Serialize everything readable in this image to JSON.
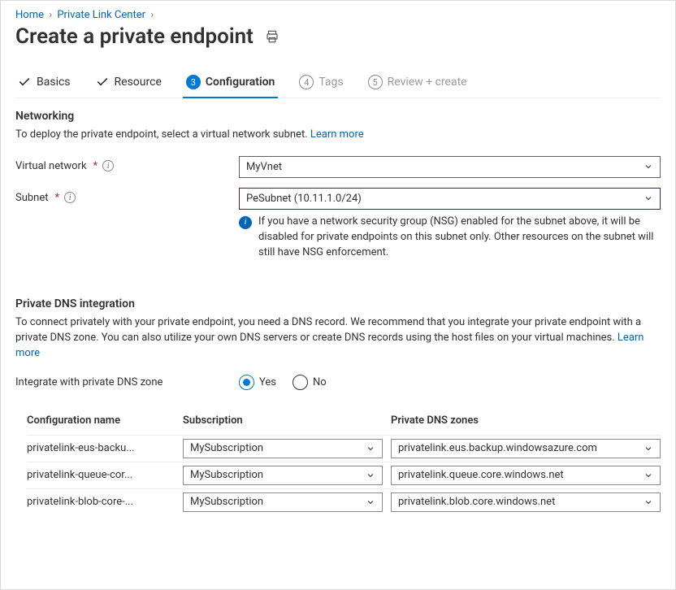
{
  "breadcrumb": {
    "home": "Home",
    "plc": "Private Link Center"
  },
  "title": "Create a private endpoint",
  "tabs": {
    "basics": "Basics",
    "resource": "Resource",
    "configuration_num": "3",
    "configuration": "Configuration",
    "tags_num": "4",
    "tags": "Tags",
    "review_num": "5",
    "review": "Review + create"
  },
  "networking": {
    "heading": "Networking",
    "desc": "To deploy the private endpoint, select a virtual network subnet.  ",
    "learn": "Learn more",
    "vnet_label": "Virtual network",
    "vnet_value": "MyVnet",
    "subnet_label": "Subnet",
    "subnet_value": "PeSubnet (10.11.1.0/24)",
    "nsg_info": "If you have a network security group (NSG) enabled for the subnet above, it will be disabled for private endpoints on this subnet only. Other resources on the subnet will still have NSG enforcement."
  },
  "dns": {
    "heading": "Private DNS integration",
    "desc": "To connect privately with your private endpoint, you need a DNS record. We recommend that you integrate your private endpoint with a private DNS zone. You can also utilize your own DNS servers or create DNS records using the host files on your virtual machines.  ",
    "learn": "Learn more",
    "integrate_label": "Integrate with private DNS zone",
    "yes": "Yes",
    "no": "No",
    "col_config": "Configuration name",
    "col_sub": "Subscription",
    "col_zone": "Private DNS zones",
    "rows": [
      {
        "name": "privatelink-eus-backu...",
        "sub": "MySubscription",
        "zone": "privatelink.eus.backup.windowsazure.com"
      },
      {
        "name": "privatelink-queue-cor...",
        "sub": "MySubscription",
        "zone": "privatelink.queue.core.windows.net"
      },
      {
        "name": "privatelink-blob-core-...",
        "sub": "MySubscription",
        "zone": "privatelink.blob.core.windows.net"
      }
    ]
  }
}
